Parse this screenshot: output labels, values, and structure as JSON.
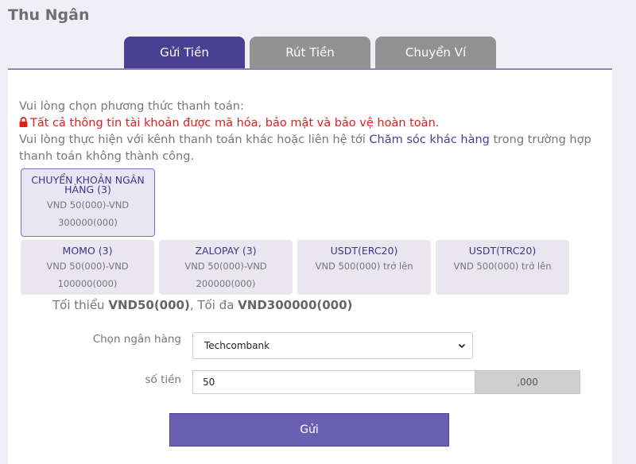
{
  "page": {
    "title": "Thu Ngân"
  },
  "tabs": [
    {
      "label": "Gửi Tiền",
      "active": true
    },
    {
      "label": "Rút Tiền",
      "active": false
    },
    {
      "label": "Chuyển Ví",
      "active": false
    }
  ],
  "intro": {
    "line1": "Vui lòng chọn phương thức thanh toán:",
    "warning": "Tất cả thông tin tài khoản được mã hóa, bảo mật và bảo vệ hoàn toàn.",
    "line3_prefix": "Vui lòng thực hiện với kênh thanh toán khác hoặc liên hệ tới ",
    "support_link": "Chăm sóc khác hàng",
    "line3_suffix": " trong trường hợp thanh toán không thành công."
  },
  "methods": [
    {
      "name": "CHUYỂN KHOẢN NGÂN HÀNG (3)",
      "range": "VND 50(000)-VND 300000(000)",
      "selected": true
    },
    {
      "name": "MOMO (3)",
      "range": "VND 50(000)-VND 100000(000)",
      "selected": false
    },
    {
      "name": "ZALOPAY (3)",
      "range": "VND 50(000)-VND 200000(000)",
      "selected": false
    },
    {
      "name": "USDT(ERC20)",
      "range": "VND 500(000) trở lên",
      "selected": false
    },
    {
      "name": "USDT(TRC20)",
      "range": "VND 500(000) trở lên",
      "selected": false
    }
  ],
  "limit": {
    "min_prefix": "Tối thiểu ",
    "min_value": "VND50(000)",
    "max_prefix": ", Tối đa ",
    "max_value": "VND300000(000)"
  },
  "form": {
    "bank_label": "Chọn ngân hàng",
    "bank_value": "Techcombank",
    "amount_label": "số tiền",
    "amount_value": "50",
    "amount_suffix": ",000",
    "submit_label": "Gửi"
  },
  "colors": {
    "accent": "#4a3f93",
    "button": "#6a5fb2",
    "warning": "#e01e1e"
  }
}
